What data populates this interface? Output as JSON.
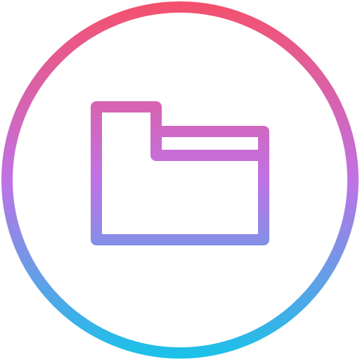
{
  "icon": {
    "name": "folder-in-circle-icon",
    "gradient_colors": {
      "top": "#F5506A",
      "middle": "#C072E6",
      "bottom": "#16C3E8"
    },
    "background": "#FFFFFF"
  }
}
